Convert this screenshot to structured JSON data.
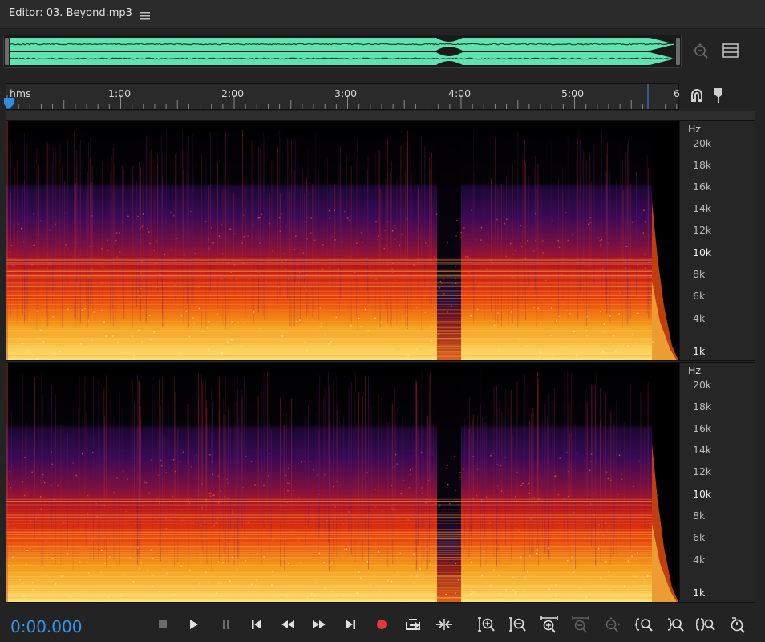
{
  "title_bar": {
    "title": "Editor: 03. Beyond.mp3",
    "menu_icon": "hamburger-icon"
  },
  "overview": {
    "waveform_color": "#5fe3b0",
    "zoom_nav_icon": "zoom-navigator-icon",
    "menu_icon": "list-icon"
  },
  "timeline": {
    "unit_label": "hms",
    "ticks": [
      "1:00",
      "2:00",
      "3:00",
      "4:00",
      "5:00",
      "6"
    ],
    "playhead_color": "#2f8fe6",
    "snap_icon": "magnet-icon",
    "marker_icon": "marker-pin-icon"
  },
  "channels": [
    {
      "hz_label": "Hz",
      "freq_ticks": [
        "20k",
        "18k",
        "16k",
        "14k",
        "12k",
        "10k",
        "8k",
        "6k",
        "4k",
        "1k"
      ]
    },
    {
      "hz_label": "Hz",
      "freq_ticks": [
        "20k",
        "18k",
        "16k",
        "14k",
        "12k",
        "10k",
        "8k",
        "6k",
        "4k",
        "1k"
      ]
    }
  ],
  "transport": {
    "current_time": "0:00.000",
    "time_color": "#2f97f0",
    "record_color": "#e53935",
    "buttons": [
      "stop",
      "play",
      "pause",
      "move-to-previous",
      "rewind",
      "fast-forward",
      "move-to-next",
      "record",
      "playback-loop",
      "skip-selection",
      "zoom-in-amplitude",
      "zoom-out-amplitude",
      "zoom-in-time",
      "zoom-out-time",
      "zoom-out-full",
      "zoom-in-at-in-point",
      "zoom-in-at-out-point",
      "zoom-to-selection",
      "zoom-reset"
    ]
  }
}
